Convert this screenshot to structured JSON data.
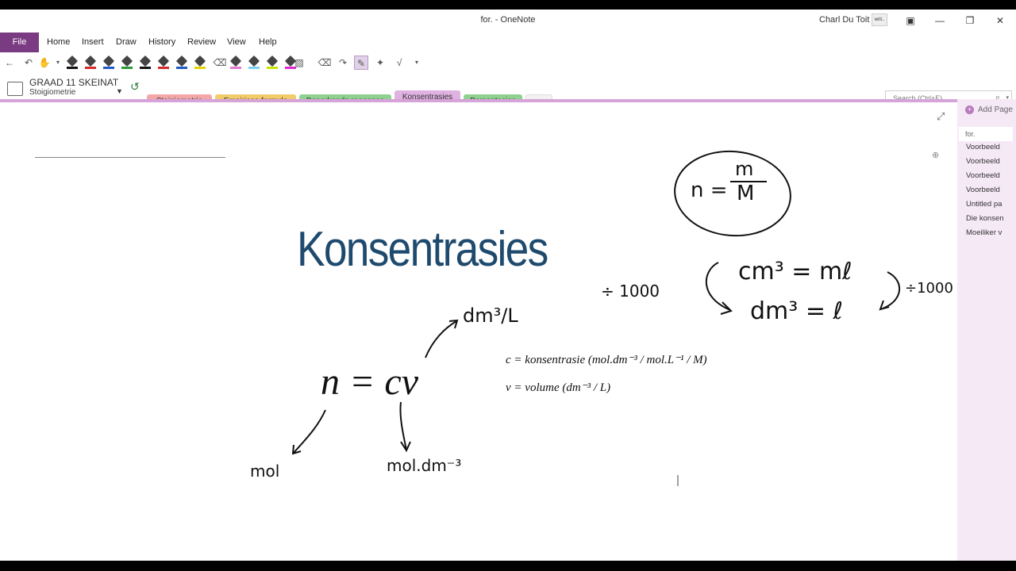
{
  "window": {
    "title": "for.  -  OneNote",
    "user": "Charl Du Toit",
    "avatar_text": "writ.."
  },
  "menu": {
    "file": "File",
    "items": [
      "Home",
      "Insert",
      "Draw",
      "History",
      "Review",
      "View",
      "Help"
    ]
  },
  "toolbar": {
    "pen_colors": [
      "#111111",
      "#d42a2a",
      "#1e5bc6",
      "#2a9a3a",
      "#111111",
      "#d42a2a",
      "#1e5bc6",
      "#e5d100",
      "#e07bd0",
      "#7ad0f0",
      "#c6e600",
      "#e02ad0"
    ]
  },
  "notebook": {
    "name": "GRAAD 11 SKEINAT",
    "section_group": "Stoigiometrie",
    "tabs": [
      {
        "label": "Stoigiometrie",
        "color": "#f3a8a8"
      },
      {
        "label": "Empiriese formule",
        "color": "#f2cc6a"
      },
      {
        "label": "Beperkende reagense",
        "color": "#8fd18f"
      },
      {
        "label": "Konsentrasies",
        "color": "#e0b2e2",
        "active": true
      },
      {
        "label": "Persentasies",
        "color": "#8fd18f"
      },
      {
        "label": "+",
        "color": "#f2f2f2"
      }
    ],
    "search_placeholder": "Search (Ctrl+E)"
  },
  "page": {
    "heading": "Konsentrasies",
    "formula_circle": {
      "n": "n =",
      "top": "m",
      "bottom": "M"
    },
    "conversion": {
      "left": "÷ 1000",
      "row1": "cm³ = mℓ",
      "row2": "dm³ = ℓ",
      "right": "÷1000"
    },
    "main_formula": "n = cv",
    "arrow_labels": {
      "unit_v": "dm³/L",
      "unit_n": "mol",
      "unit_c": "mol.dm⁻³"
    },
    "definitions": [
      "c = konsentrasie (mol.dm⁻³ / mol.L⁻¹ / M)",
      "v = volume (dm⁻³ / L)"
    ]
  },
  "pages_panel": {
    "add_page": "Add Page",
    "current_title": "for.",
    "items": [
      "Voorbeeld",
      "Voorbeeld",
      "Voorbeeld",
      "Voorbeeld",
      "Untitled pa",
      "Die konsen",
      "Moeiliker v"
    ]
  }
}
